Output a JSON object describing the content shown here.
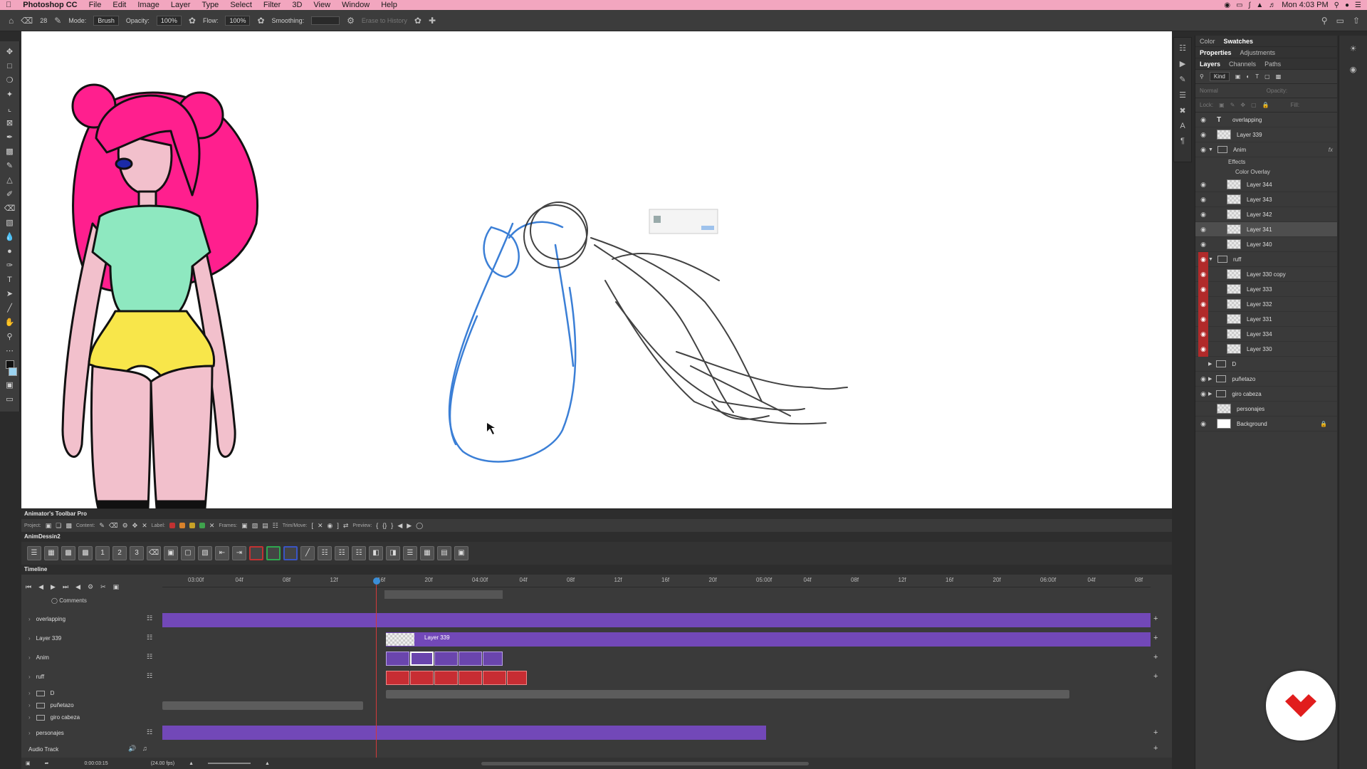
{
  "menubar": {
    "app": "Photoshop CC",
    "items": [
      "File",
      "Edit",
      "Image",
      "Layer",
      "Type",
      "Select",
      "Filter",
      "3D",
      "View",
      "Window",
      "Help"
    ],
    "clock": "Mon 4:03 PM"
  },
  "options": {
    "brush_size": "28",
    "mode_label": "Mode:",
    "mode_value": "Brush",
    "opacity_label": "Opacity:",
    "opacity_value": "100%",
    "flow_label": "Flow:",
    "flow_value": "100%",
    "smoothing_label": "Smoothing:",
    "erase_history": "Erase to History"
  },
  "panels": {
    "tabs_top": [
      "Color",
      "Swatches"
    ],
    "tabs_mid": [
      "Properties",
      "Adjustments"
    ],
    "tabs_layers": [
      "Layers",
      "Channels",
      "Paths"
    ],
    "filter_kind": "Kind",
    "blend_mode": "Normal",
    "opacity_label": "Opacity:",
    "lock_label": "Lock:",
    "fill_label": "Fill:"
  },
  "layers": [
    {
      "name": "overlapping",
      "kind": "text",
      "eye": "normal"
    },
    {
      "name": "Layer 339",
      "kind": "layer",
      "eye": "normal"
    },
    {
      "name": "Anim",
      "kind": "group",
      "eye": "normal",
      "fx": "fx"
    },
    {
      "name": "Effects",
      "kind": "effect"
    },
    {
      "name": "Color Overlay",
      "kind": "effect-sub"
    },
    {
      "name": "Layer 344",
      "kind": "layer",
      "eye": "normal",
      "indent": true
    },
    {
      "name": "Layer 343",
      "kind": "layer",
      "eye": "normal",
      "indent": true
    },
    {
      "name": "Layer 342",
      "kind": "layer",
      "eye": "normal",
      "indent": true
    },
    {
      "name": "Layer 341",
      "kind": "layer",
      "eye": "normal",
      "indent": true,
      "selected": true
    },
    {
      "name": "Layer 340",
      "kind": "layer",
      "eye": "normal",
      "indent": true
    },
    {
      "name": "ruff",
      "kind": "group",
      "eye": "red"
    },
    {
      "name": "Layer 330 copy",
      "kind": "layer",
      "eye": "red",
      "indent": true
    },
    {
      "name": "Layer 333",
      "kind": "layer",
      "eye": "red",
      "indent": true
    },
    {
      "name": "Layer 332",
      "kind": "layer",
      "eye": "red",
      "indent": true
    },
    {
      "name": "Layer 331",
      "kind": "layer",
      "eye": "red",
      "indent": true
    },
    {
      "name": "Layer 334",
      "kind": "layer",
      "eye": "red",
      "indent": true
    },
    {
      "name": "Layer 330",
      "kind": "layer",
      "eye": "red",
      "indent": true
    },
    {
      "name": "D",
      "kind": "group",
      "eye": "none"
    },
    {
      "name": "puñetazo",
      "kind": "group",
      "eye": "normal"
    },
    {
      "name": "giro cabeza",
      "kind": "group",
      "eye": "normal"
    },
    {
      "name": "personajes",
      "kind": "layer",
      "eye": "none"
    },
    {
      "name": "Background",
      "kind": "background",
      "eye": "normal",
      "locked": true
    }
  ],
  "animator": {
    "title": "Animator's Toolbar Pro",
    "project_label": "Project:",
    "content_label": "Content:",
    "label_label": "Label:",
    "frames_label": "Frames:",
    "trim_label": "Trim/Move:",
    "preview_label": "Preview:",
    "subpanel": "AnimDessin2",
    "label_colors": [
      "#c23232",
      "#d9822b",
      "#c8a227",
      "#3fa34d"
    ]
  },
  "timeline": {
    "title": "Timeline",
    "comments": "Comments",
    "ticks": [
      "03:00f",
      "04f",
      "08f",
      "12f",
      "16f",
      "20f",
      "04:00f",
      "04f",
      "08f",
      "12f",
      "16f",
      "20f",
      "05:00f",
      "04f",
      "08f",
      "12f",
      "16f",
      "20f",
      "06:00f",
      "04f",
      "08f"
    ],
    "tracks": [
      "overlapping",
      "Layer 339",
      "Anim",
      "ruff",
      "D",
      "puñetazo",
      "giro cabeza",
      "personajes"
    ],
    "clip_label": "Layer 339",
    "audio": "Audio Track",
    "timecode": "0:00:03:15",
    "fps": "(24.00 fps)"
  }
}
